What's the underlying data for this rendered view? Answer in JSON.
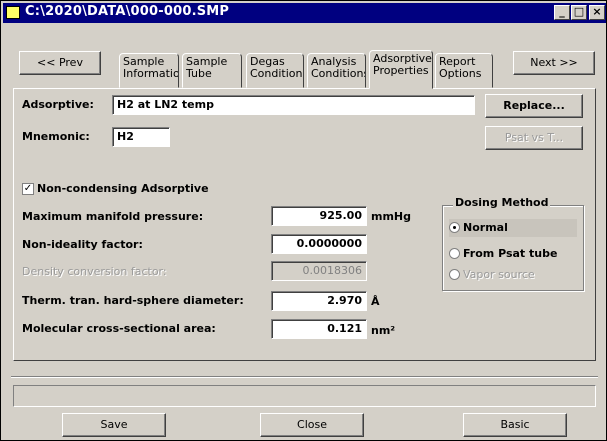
{
  "window": {
    "title": "C:\\2020\\DATA\\000-000.SMP"
  },
  "controls": {
    "minimize": "_",
    "maximize": "□",
    "close": "×"
  },
  "nav": {
    "prev_label": "<< Prev",
    "next_label": "Next >>"
  },
  "tabs": [
    {
      "label": "Sample\nInformation"
    },
    {
      "label": "Sample\nTube"
    },
    {
      "label": "Degas\nConditions"
    },
    {
      "label": "Analysis\nConditions"
    },
    {
      "label": "Adsorptive\nProperties"
    },
    {
      "label": "Report\nOptions"
    }
  ],
  "form": {
    "adsorptive_label": "Adsorptive:",
    "adsorptive_value": "H2 at LN2 temp",
    "replace_label": "Replace...",
    "mnemonic_label": "Mnemonic:",
    "mnemonic_value": "H2",
    "psat_label": "Psat vs T...",
    "noncond_label": "Non-condensing Adsorptive",
    "noncond_checked": true,
    "max_pressure_label": "Maximum manifold pressure:",
    "max_pressure_value": "925.00",
    "max_pressure_unit": "mmHg",
    "nonideality_label": "Non-ideality factor:",
    "nonideality_value": "0.0000000",
    "density_label": "Density conversion factor:",
    "density_value": "0.0018306",
    "diameter_label": "Therm. tran. hard-sphere diameter:",
    "diameter_value": "2.970",
    "diameter_unit": "Å",
    "area_label": "Molecular cross-sectional area:",
    "area_value": "0.121",
    "area_unit": "nm²"
  },
  "dosing": {
    "title": "Dosing Method",
    "options": [
      {
        "label": "Normal",
        "selected": true,
        "enabled": true
      },
      {
        "label": "From Psat tube",
        "selected": false,
        "enabled": true
      },
      {
        "label": "Vapor source",
        "selected": false,
        "enabled": false
      }
    ]
  },
  "footer": {
    "save_label": "Save",
    "close_label": "Close",
    "basic_label": "Basic",
    "status_text": ""
  }
}
